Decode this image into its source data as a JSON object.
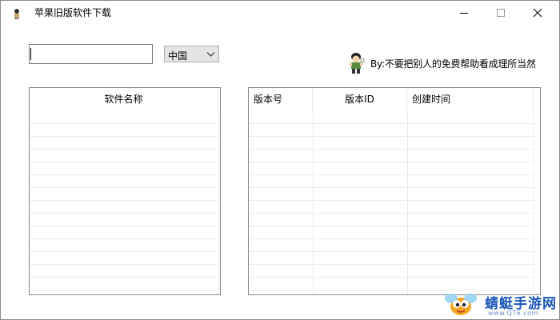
{
  "window": {
    "title": "苹果旧版软件下载"
  },
  "titlebar_buttons": {
    "minimize": "minimize-icon",
    "maximize": "maximize-icon",
    "close": "close-icon"
  },
  "search": {
    "value": "",
    "placeholder": ""
  },
  "region_select": {
    "selected": "中国"
  },
  "author": {
    "label": "By:不要把别人的免费帮助看成理所当然"
  },
  "app_list": {
    "columns": [
      "软件名称"
    ],
    "rows": []
  },
  "version_list": {
    "columns": [
      "版本号",
      "版本ID",
      "创建时间"
    ],
    "rows": []
  },
  "watermark": {
    "name": "蜻蜓手游网",
    "url": "www.QT6.com"
  },
  "colors": {
    "border": "#828790",
    "grid": "#ececec",
    "watermark_blue": "#1a56b8"
  }
}
